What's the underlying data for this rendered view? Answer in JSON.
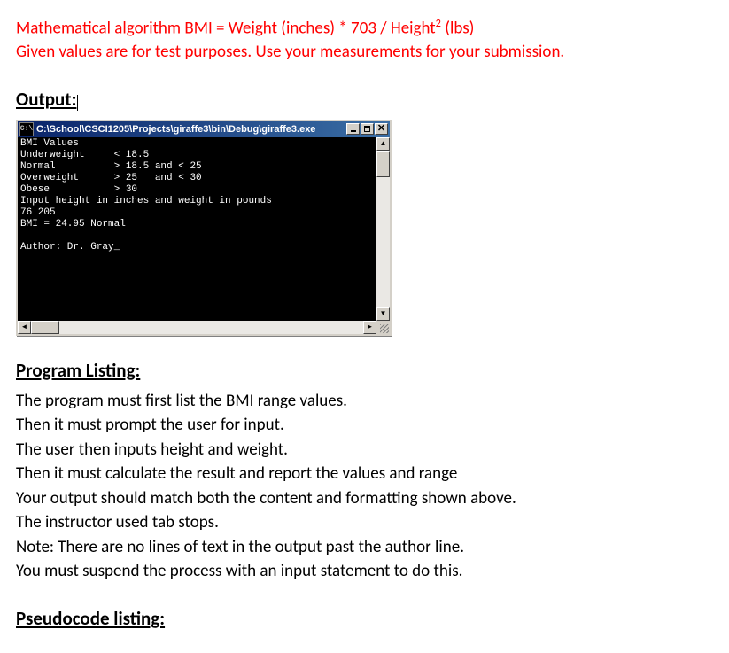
{
  "intro": {
    "line1_pre": "Mathematical algorithm BMI = Weight (inches) * 703 / Height",
    "line1_sup": "2",
    "line1_post": " (lbs)",
    "line2": "Given values are for test purposes. Use your measurements for your submission."
  },
  "output_header": "Output:",
  "console": {
    "title_icon_text": "C:\\",
    "title": "C:\\School\\CSCI1205\\Projects\\giraffe3\\bin\\Debug\\giraffe3.exe",
    "lines": "BMI Values\nUnderweight\t< 18.5\nNormal\t\t> 18.5 and < 25\nOverweight\t> 25   and < 30\nObese\t\t> 30\nInput height in inches and weight in pounds\n76 205\nBMI = 24.95 Normal\n\nAuthor: Dr. Gray_"
  },
  "program_listing": {
    "header": "Program Listing:",
    "lines": [
      "The program must first list the BMI range values.",
      "Then it must prompt the user for input.",
      "The user then inputs height and weight.",
      "Then it must calculate the result and report the values and range",
      "Your output should match both the content and formatting shown above.",
      "The instructor used tab stops.",
      "Note: There are no lines of text in the output past the author line.",
      "You must suspend the process with an input statement to do this."
    ]
  },
  "pseudocode_header": "Pseudocode listing:"
}
